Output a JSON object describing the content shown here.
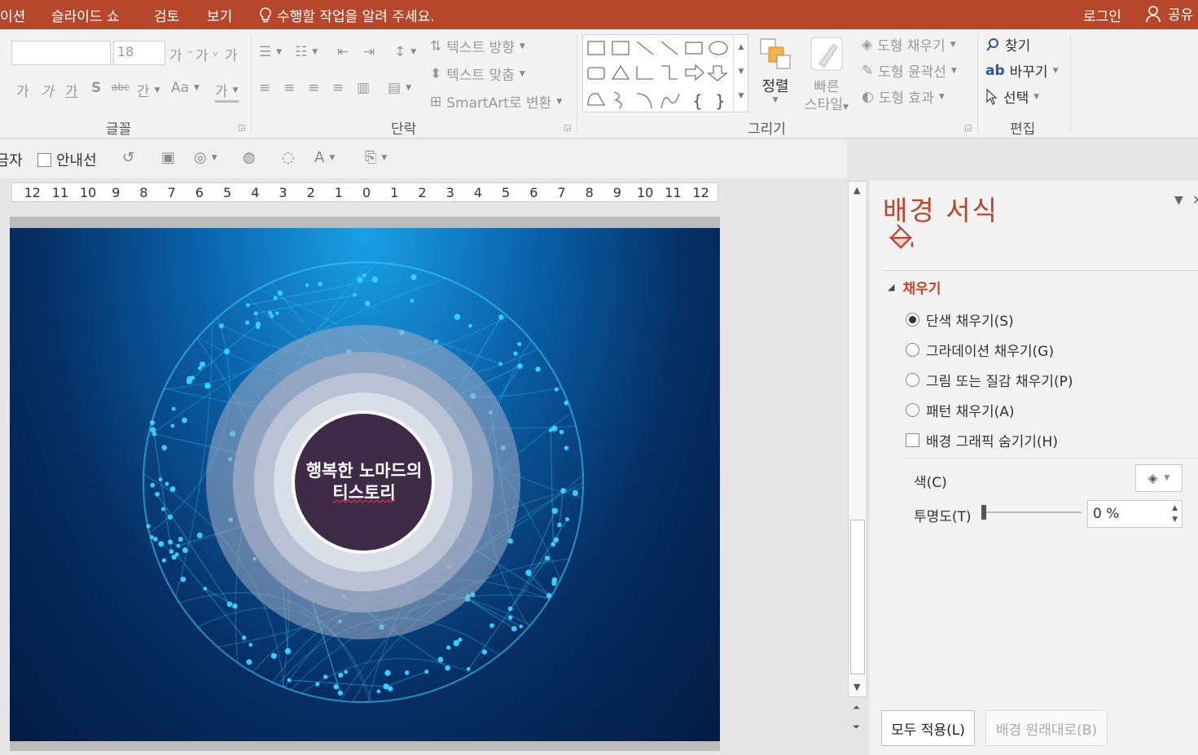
{
  "titlebar": {
    "tabs": [
      "이션",
      "슬라이드 쇼",
      "검토",
      "보기"
    ],
    "tell_me": "수행할 작업을 알려 주세요.",
    "login": "로그인",
    "share": "공유"
  },
  "ribbon": {
    "font_size": "18",
    "font_buttons": [
      "가",
      "가",
      "가",
      "S",
      "abc",
      "간",
      "Aa",
      "가"
    ],
    "groups": {
      "font": "글꼴",
      "paragraph": "단락",
      "drawing": "그리기",
      "editing": "편집"
    },
    "paragraph": {
      "text_direction": "텍스트 방향",
      "align_text": "텍스트 맞춤",
      "smartart": "SmartArt로 변환"
    },
    "drawing": {
      "arrange": "정렬",
      "quick_styles_1": "빠른",
      "quick_styles_2": "스타일",
      "shape_fill": "도형 채우기",
      "shape_outline": "도형 윤곽선",
      "shape_effects": "도형 효과"
    },
    "editing": {
      "find": "찾기",
      "replace": "바꾸기",
      "select": "선택"
    }
  },
  "quickbar": {
    "ruler_item": "눈금자",
    "guides": "안내선"
  },
  "ruler": {
    "labels": [
      "12",
      "11",
      "10",
      "9",
      "8",
      "7",
      "6",
      "5",
      "4",
      "3",
      "2",
      "1",
      "0",
      "1",
      "2",
      "3",
      "4",
      "5",
      "6",
      "7",
      "8",
      "9",
      "10",
      "11",
      "12"
    ]
  },
  "slide": {
    "title_line1": "행복한 노마드의",
    "title_line2": "티스토리",
    "colors": {
      "circle": "#3f2a48",
      "ring1": "#a3adc4",
      "ring2": "#c3c9d7",
      "ring3": "#dfe3ea",
      "network": "#33d0ff"
    }
  },
  "pane": {
    "title": "배경 서식",
    "section": "채우기",
    "options": [
      {
        "label": "단색 채우기(S)",
        "checked": true
      },
      {
        "label": "그라데이션 채우기(G)",
        "checked": false
      },
      {
        "label": "그림 또는 질감 채우기(P)",
        "checked": false
      },
      {
        "label": "패턴 채우기(A)",
        "checked": false
      }
    ],
    "hide_graphics": "배경 그래픽 숨기기(H)",
    "color_label": "색(C)",
    "transparency_label": "투명도(T)",
    "transparency_value": "0 %",
    "apply_all": "모두 적용(L)",
    "reset": "배경 원래대로(B)"
  }
}
